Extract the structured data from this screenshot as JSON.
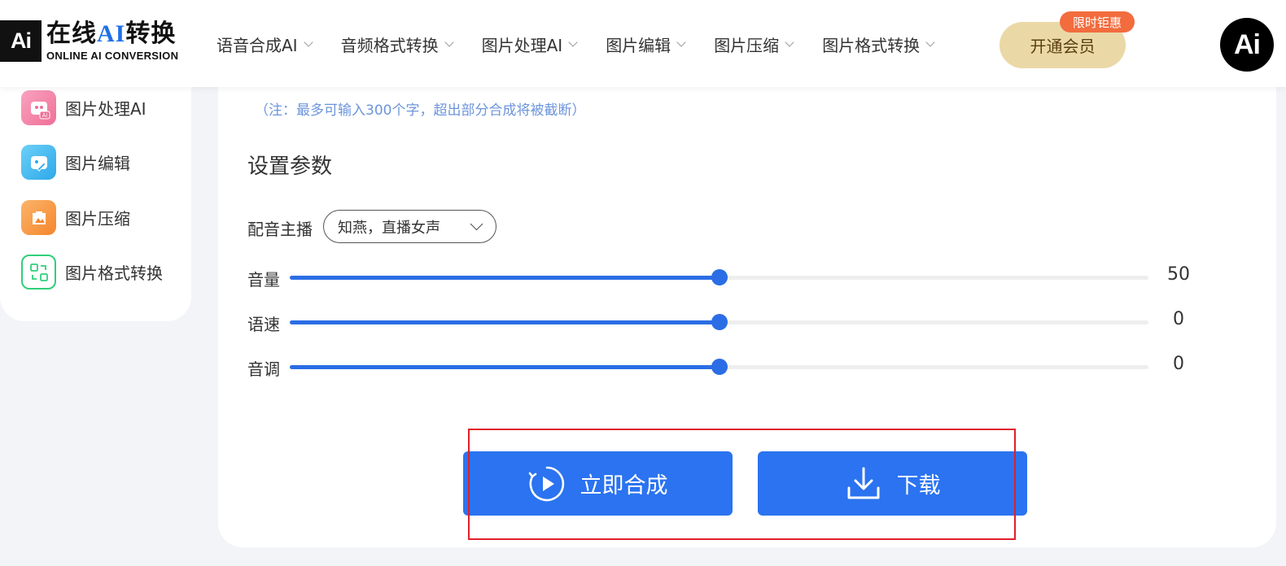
{
  "header": {
    "logo_mark": "Ai",
    "logo_cn_prefix": "在线",
    "logo_cn_ai": "AI",
    "logo_cn_suffix": "转换",
    "logo_en": "ONLINE AI CONVERSION",
    "nav": [
      {
        "label": "语音合成AI"
      },
      {
        "label": "音频格式转换"
      },
      {
        "label": "图片处理AI"
      },
      {
        "label": "图片编辑"
      },
      {
        "label": "图片压缩"
      },
      {
        "label": "图片格式转换"
      }
    ],
    "vip_label": "开通会员",
    "vip_badge": "限时钜惠",
    "avatar_text": "Ai"
  },
  "sidebar": {
    "items": [
      {
        "label": "图片处理AI",
        "icon": "image-ai-icon",
        "color": "#f27aa0"
      },
      {
        "label": "图片编辑",
        "icon": "image-edit-icon",
        "color": "#3fb8ee"
      },
      {
        "label": "图片压缩",
        "icon": "image-compress-icon",
        "color": "#f99a46"
      },
      {
        "label": "图片格式转换",
        "icon": "image-convert-icon",
        "color": "#2fcf7b"
      }
    ]
  },
  "main": {
    "note": "（注：最多可输入300个字，超出部分合成将被截断）",
    "section_title": "设置参数",
    "voice_label": "配音主播",
    "voice_value": "知燕，直播女声",
    "sliders": [
      {
        "label": "音量",
        "value": "50",
        "fraction": 0.5
      },
      {
        "label": "语速",
        "value": "0",
        "fraction": 0.5
      },
      {
        "label": "音调",
        "value": "0",
        "fraction": 0.5
      }
    ],
    "synth_button": "立即合成",
    "download_button": "下载"
  },
  "colors": {
    "accent": "#2b73f0",
    "vip_bg": "#ead9a7",
    "badge": "#f26c3e",
    "highlight_box": "#e0202a"
  }
}
